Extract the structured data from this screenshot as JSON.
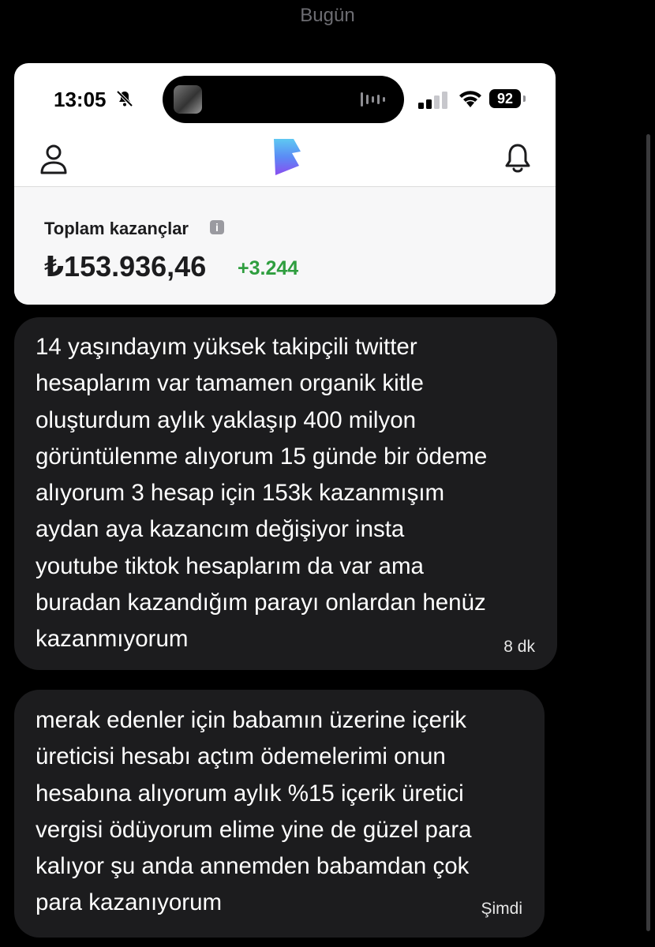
{
  "chat": {
    "date_header": "Bugün"
  },
  "attachment": {
    "status_bar": {
      "time": "13:05",
      "battery": "92"
    },
    "earnings": {
      "label": "Toplam kazançlar",
      "info_glyph": "i",
      "amount": "₺153.936,46",
      "delta": "+3.244",
      "delta_color": "#2f9e3f"
    },
    "icons": [
      "bell-off-icon",
      "waveform-icon",
      "signal-icon",
      "wifi-icon",
      "user-icon",
      "app-logo",
      "bell-icon"
    ]
  },
  "messages": [
    {
      "lines": [
        "14 yaşındayım yüksek takipçili twitter",
        "hesaplarım var tamamen organik kitle",
        "oluşturdum aylık yaklaşıp 400 milyon",
        "görüntülenme alıyorum 15 günde bir ödeme",
        "alıyorum 3 hesap için 153k kazanmışım",
        "aydan aya kazancım değişiyor insta",
        "youtube tiktok hesaplarım da var ama",
        "buradan kazandığım parayı onlardan henüz",
        "kazanmıyorum"
      ],
      "time": "8 dk"
    },
    {
      "lines": [
        "merak edenler için babamın üzerine içerik",
        "üreticisi hesabı açtım ödemelerimi onun",
        "hesabına alıyorum aylık %15 içerik üretici",
        "vergisi ödüyorum elime yine de güzel para",
        "kalıyor şu anda annemden babamdan çok",
        "para kazanıyorum"
      ],
      "time": "Şimdi"
    }
  ],
  "colors": {
    "background": "#000000",
    "bubble": "#1c1c1e",
    "text": "#ffffff",
    "muted": "#6d6d72"
  }
}
